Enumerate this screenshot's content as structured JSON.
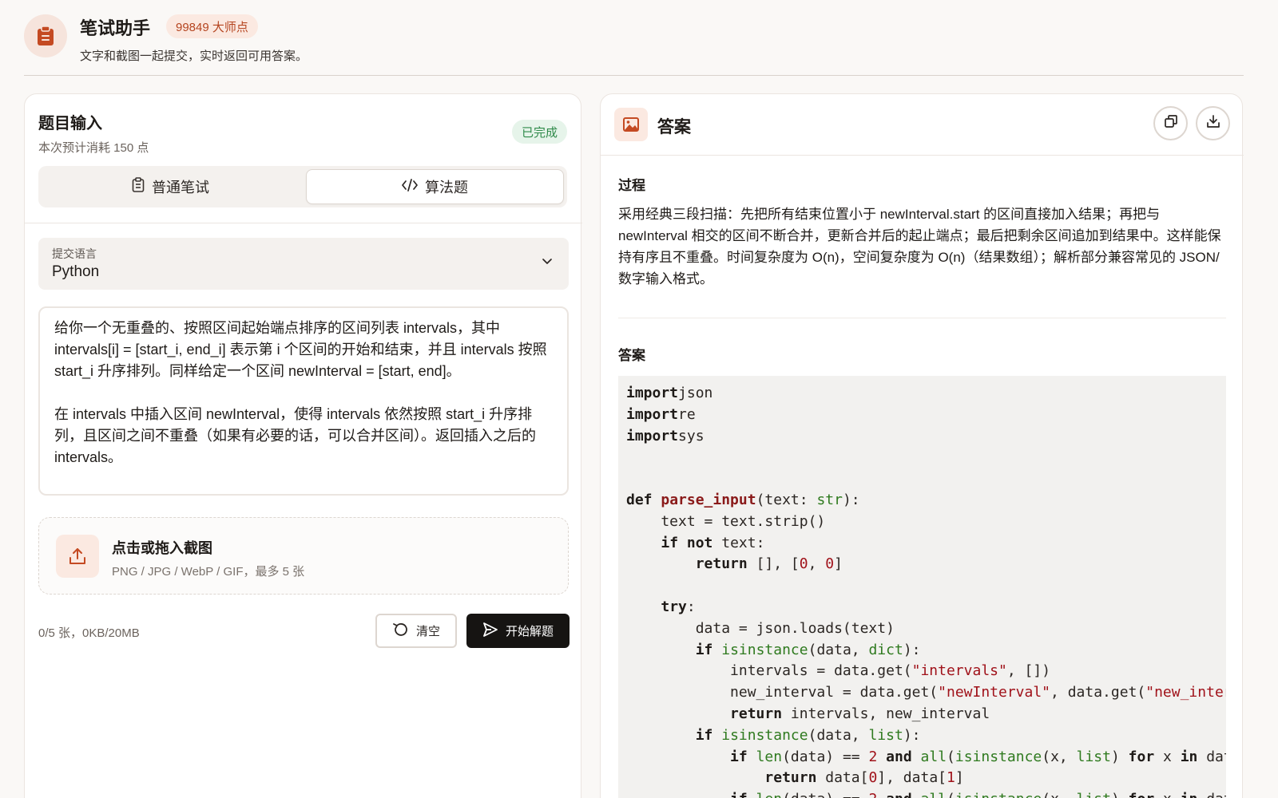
{
  "header": {
    "title": "笔试助手",
    "points": "99849 大师点",
    "subtitle": "文字和截图一起提交，实时返回可用答案。"
  },
  "input_panel": {
    "title": "题目输入",
    "cost": "本次预计消耗 150 点",
    "status": "已完成",
    "tabs": [
      {
        "label": "普通笔试",
        "icon": "clipboard-icon",
        "selected": false
      },
      {
        "label": "算法题",
        "icon": "code-icon",
        "selected": true
      }
    ],
    "language": {
      "label": "提交语言",
      "value": "Python"
    },
    "question": "给你一个无重叠的、按照区间起始端点排序的区间列表 intervals，其中 intervals[i] = [start_i, end_i] 表示第 i 个区间的开始和结束，并且 intervals 按照 start_i 升序排列。同样给定一个区间 newInterval = [start, end]。\n\n在 intervals 中插入区间 newInterval，使得 intervals 依然按照 start_i 升序排列，且区间之间不重叠（如果有必要的话，可以合并区间）。返回插入之后的 intervals。",
    "upload": {
      "title": "点击或拖入截图",
      "hint": "PNG / JPG / WebP / GIF，最多 5 张"
    },
    "quota": "0/5 张，0KB/20MB",
    "clear_label": "清空",
    "solve_label": "开始解题"
  },
  "answer_panel": {
    "title": "答案",
    "process_label": "过程",
    "process_text": "采用经典三段扫描：先把所有结束位置小于 newInterval.start 的区间直接加入结果；再把与 newInterval 相交的区间不断合并，更新合并后的起止端点；最后把剩余区间追加到结果中。这样能保持有序且不重叠。时间复杂度为 O(n)，空间复杂度为 O(n)（结果数组）；解析部分兼容常见的 JSON/数字输入格式。",
    "answer_label": "答案",
    "code": [
      [
        [
          "kw",
          "import"
        ],
        [
          "",
          "json"
        ]
      ],
      [
        [
          "kw",
          "import"
        ],
        [
          "",
          "re"
        ]
      ],
      [
        [
          "kw",
          "import"
        ],
        [
          "",
          "sys"
        ]
      ],
      [],
      [],
      [
        [
          "kw",
          "def"
        ],
        [
          "",
          " "
        ],
        [
          "fn",
          "parse_input"
        ],
        [
          "",
          "(text: "
        ],
        [
          "bi",
          "str"
        ],
        [
          "",
          "):"
        ]
      ],
      [
        [
          "",
          "    text = text.strip()"
        ]
      ],
      [
        [
          "",
          "    "
        ],
        [
          "kw",
          "if not"
        ],
        [
          "",
          ""
        ],
        [
          "",
          " text:"
        ]
      ],
      [
        [
          "",
          "        "
        ],
        [
          "kw",
          "return"
        ],
        [
          "",
          " [], ["
        ],
        [
          "num",
          "0"
        ],
        [
          "",
          ", "
        ],
        [
          "num",
          "0"
        ],
        [
          "",
          "]"
        ]
      ],
      [],
      [
        [
          "",
          "    "
        ],
        [
          "kw",
          "try"
        ],
        [
          "",
          ":"
        ]
      ],
      [
        [
          "",
          "        data = json.loads(text)"
        ]
      ],
      [
        [
          "",
          "        "
        ],
        [
          "kw",
          "if"
        ],
        [
          "",
          " "
        ],
        [
          "bi",
          "isinstance"
        ],
        [
          "",
          "(data, "
        ],
        [
          "bi",
          "dict"
        ],
        [
          "",
          "):"
        ]
      ],
      [
        [
          "",
          "            intervals = data.get("
        ],
        [
          "str",
          "\"intervals\""
        ],
        [
          "",
          ", [])"
        ]
      ],
      [
        [
          "",
          "            new_interval = data.get("
        ],
        [
          "str",
          "\"newInterval\""
        ],
        [
          "",
          ", data.get("
        ],
        [
          "str",
          "\"new_interval\""
        ],
        [
          "",
          ", []))"
        ]
      ],
      [
        [
          "",
          "            "
        ],
        [
          "kw",
          "return"
        ],
        [
          "",
          " intervals, new_interval"
        ]
      ],
      [
        [
          "",
          "        "
        ],
        [
          "kw",
          "if"
        ],
        [
          "",
          " "
        ],
        [
          "bi",
          "isinstance"
        ],
        [
          "",
          "(data, "
        ],
        [
          "bi",
          "list"
        ],
        [
          "",
          "):"
        ]
      ],
      [
        [
          "",
          "            "
        ],
        [
          "kw",
          "if"
        ],
        [
          "",
          " "
        ],
        [
          "bi",
          "len"
        ],
        [
          "",
          "(data) == "
        ],
        [
          "num",
          "2"
        ],
        [
          "",
          " "
        ],
        [
          "kw",
          "and"
        ],
        [
          "",
          " "
        ],
        [
          "bi",
          "all"
        ],
        [
          "",
          "("
        ],
        [
          "bi",
          "isinstance"
        ],
        [
          "",
          "(x, "
        ],
        [
          "bi",
          "list"
        ],
        [
          "",
          ") "
        ],
        [
          "kw",
          "for"
        ],
        [
          "",
          " x "
        ],
        [
          "kw",
          "in"
        ],
        [
          "",
          " data):"
        ]
      ],
      [
        [
          "",
          "                "
        ],
        [
          "kw",
          "return"
        ],
        [
          "",
          " data["
        ],
        [
          "num",
          "0"
        ],
        [
          "",
          "], data["
        ],
        [
          "num",
          "1"
        ],
        [
          "",
          "]"
        ]
      ],
      [
        [
          "",
          "            "
        ],
        [
          "kw",
          "if"
        ],
        [
          "",
          " "
        ],
        [
          "bi",
          "len"
        ],
        [
          "",
          "(data) == "
        ],
        [
          "num",
          "2"
        ],
        [
          "",
          " "
        ],
        [
          "kw",
          "and"
        ],
        [
          "",
          " "
        ],
        [
          "bi",
          "all"
        ],
        [
          "",
          "("
        ],
        [
          "bi",
          "isinstance"
        ],
        [
          "",
          "(x, "
        ],
        [
          "bi",
          "list"
        ],
        [
          "",
          ") "
        ],
        [
          "kw",
          "for"
        ],
        [
          "",
          " x "
        ],
        [
          "kw",
          "in"
        ],
        [
          "",
          " data):"
        ]
      ]
    ]
  }
}
